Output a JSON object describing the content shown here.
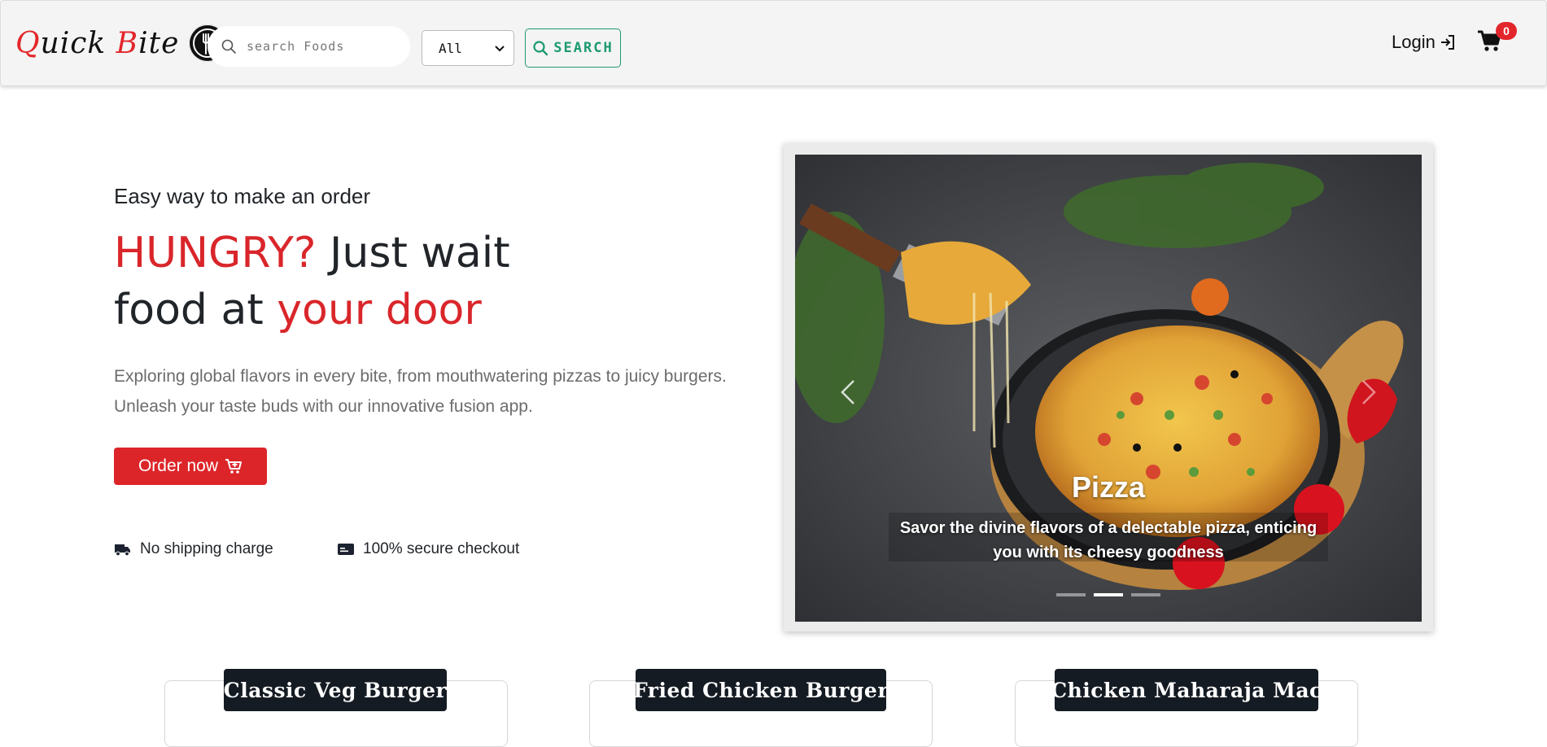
{
  "brand": {
    "name_q": "Q",
    "name_uick": "uick ",
    "name_b": "B",
    "name_ite": "ite"
  },
  "search": {
    "placeholder": "search Foods",
    "category_selected": "All",
    "button_label": "SEARCH"
  },
  "nav": {
    "login_label": "Login",
    "cart_count": "0"
  },
  "hero": {
    "subtitle": "Easy way to make an order",
    "title_red1": "HUNGRY?",
    "title_dark1": " Just wait",
    "title_dark2": "food at ",
    "title_red2": "your door",
    "description": "Exploring global flavors in every bite, from mouthwatering pizzas to juicy burgers. Unleash your taste buds with our innovative fusion app.",
    "order_button": "Order now",
    "features": [
      {
        "label": "No shipping charge",
        "icon": "truck-icon"
      },
      {
        "label": "100% secure checkout",
        "icon": "credit-card-icon"
      }
    ]
  },
  "carousel": {
    "title": "Pizza",
    "text": "Savor the divine flavors of a delectable pizza, enticing you with its cheesy goodness",
    "slide_count": 3,
    "active_slide": 2
  },
  "products": [
    {
      "title": "Classic Veg Burger"
    },
    {
      "title": "Fried Chicken Burger"
    },
    {
      "title": "Chicken Maharaja Mac"
    }
  ],
  "colors": {
    "accent_red": "#dc2529",
    "accent_green": "#1d9a70",
    "nav_bg": "#f4f4f4",
    "dark": "#151b23"
  }
}
